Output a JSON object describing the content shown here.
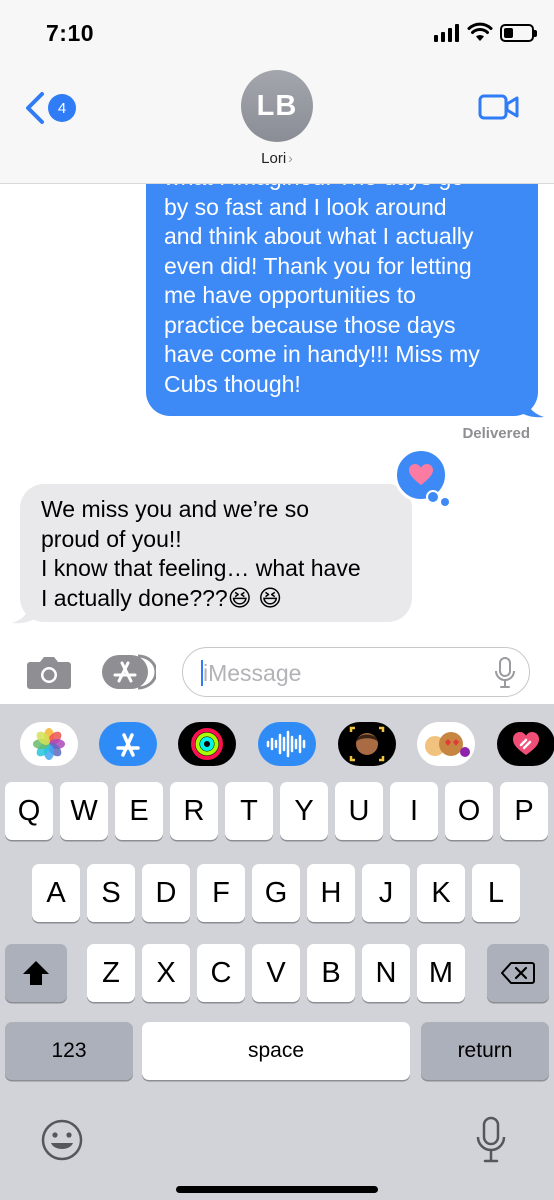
{
  "status_bar": {
    "time": "7:10"
  },
  "header": {
    "back_badge_count": "4",
    "avatar_initials": "LB",
    "contact_name": "Lori",
    "contact_chevron": "›",
    "back_icon": "chevron-left-icon",
    "video_icon": "video-camera-icon"
  },
  "conversation": {
    "sent_lines": [
      "what I imagined. The days go",
      "by so fast and I look around",
      "and think about what I actually",
      "even did! Thank you for letting",
      "me have opportunities to",
      "practice because those days",
      "have come in handy!!! Miss my",
      "Cubs though!"
    ],
    "delivered_label": "Delivered",
    "tapback": "heart",
    "received_lines": [
      "We miss you and we’re so",
      "proud of you!!",
      "I know that feeling… what have",
      "I actually done???😆 😆"
    ]
  },
  "composer": {
    "placeholder": "iMessage",
    "camera_icon": "camera-icon",
    "apps_icon": "app-store-icon",
    "mic_icon": "microphone-icon"
  },
  "keyboard": {
    "app_drawer": [
      "photos",
      "app-store",
      "activity",
      "audio-message",
      "memoji",
      "memoji-stickers",
      "digital-touch"
    ],
    "row1": [
      "Q",
      "W",
      "E",
      "R",
      "T",
      "Y",
      "U",
      "I",
      "O",
      "P"
    ],
    "row2": [
      "A",
      "S",
      "D",
      "F",
      "G",
      "H",
      "J",
      "K",
      "L"
    ],
    "row3": [
      "Z",
      "X",
      "C",
      "V",
      "B",
      "N",
      "M"
    ],
    "numbers_label": "123",
    "space_label": "space",
    "return_label": "return"
  },
  "colors": {
    "imessage_blue": "#3d8af7",
    "received_gray": "#e9e9eb",
    "keyboard_bg": "#d1d3d9",
    "tint": "#2f7cf6"
  }
}
